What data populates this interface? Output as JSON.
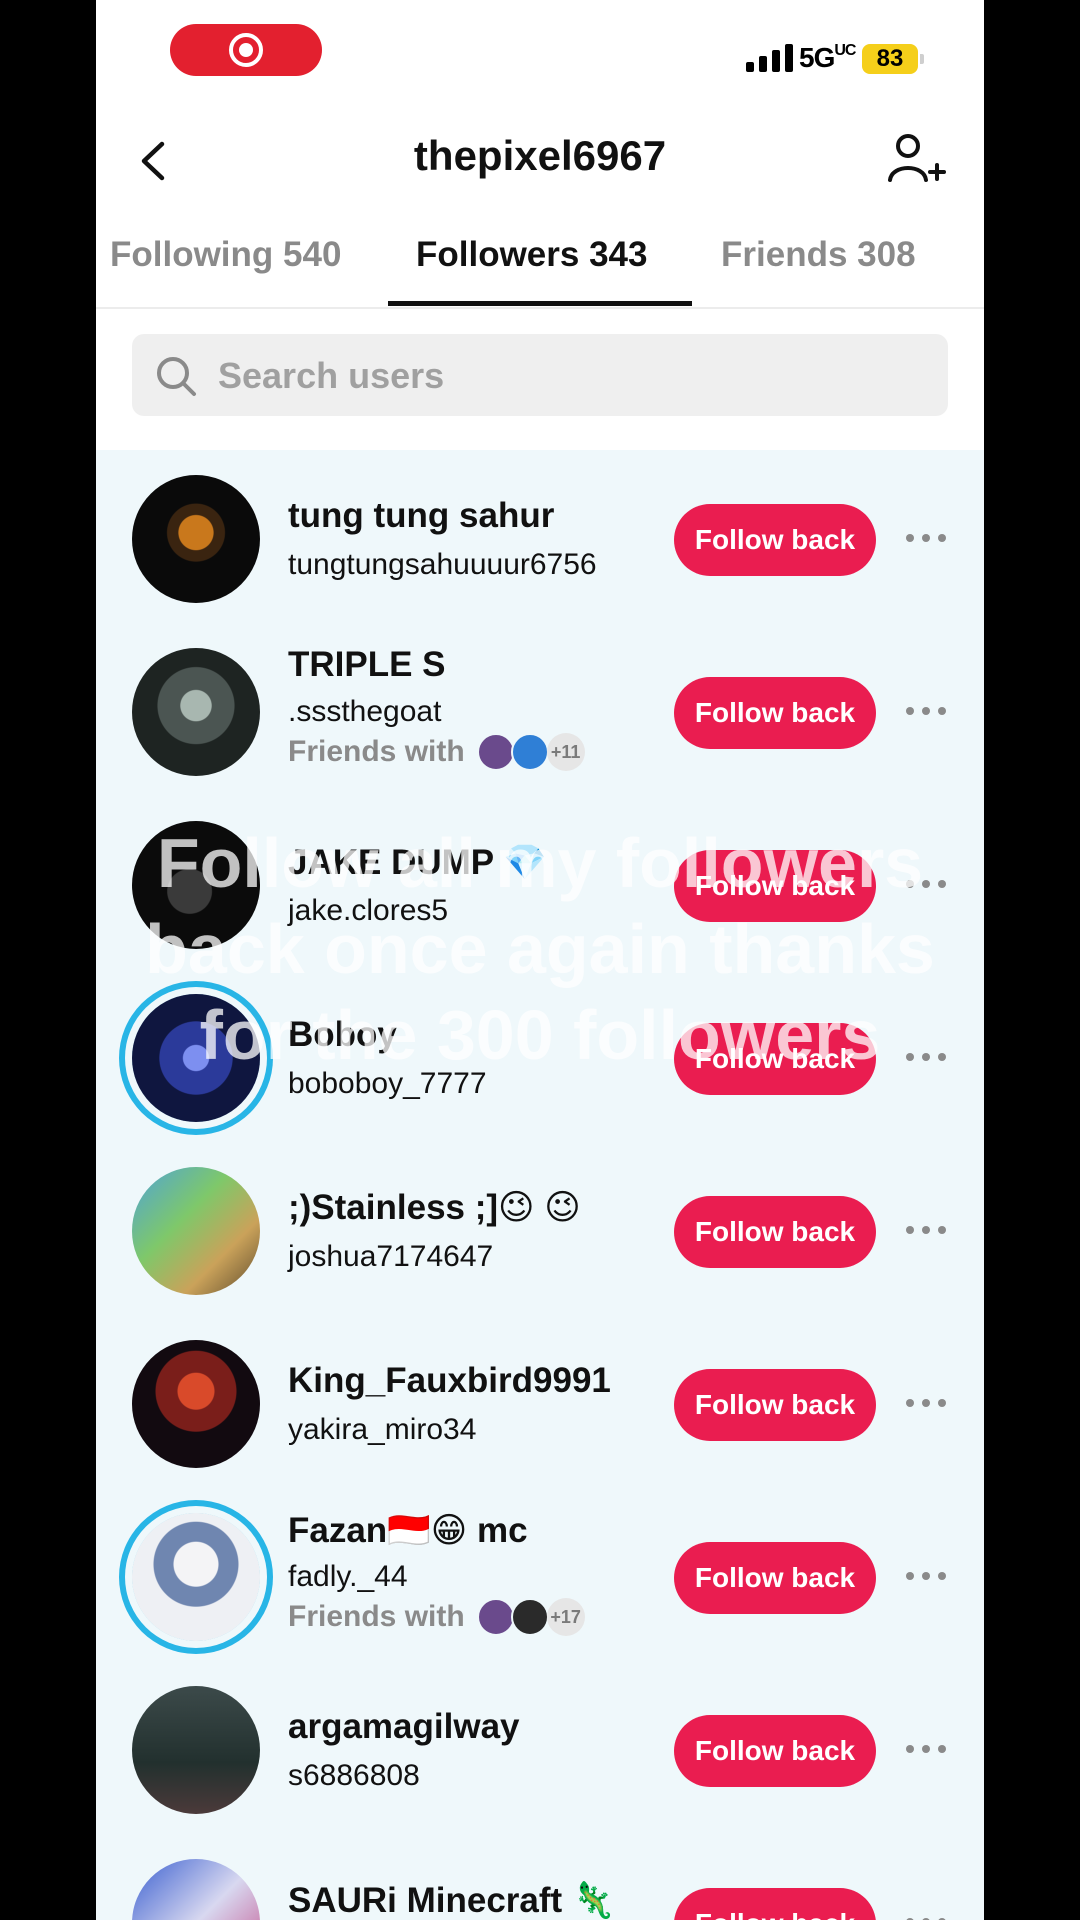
{
  "status_bar": {
    "network": "5G",
    "network_suffix": "UC",
    "battery": "83"
  },
  "header": {
    "title": "thepixel6967"
  },
  "tabs": [
    {
      "label": "Following 540",
      "active": false
    },
    {
      "label": "Followers 343",
      "active": true
    },
    {
      "label": "Friends 308",
      "active": false
    }
  ],
  "search": {
    "placeholder": "Search users"
  },
  "follow_label": "Follow back",
  "friends_with_label": "Friends with",
  "users": [
    {
      "name": "tung tung sahur",
      "handle": "tungtungsahuuuur6756"
    },
    {
      "name": "TRIPLE S",
      "handle": ".sssthegoat",
      "friends_count": "+11"
    },
    {
      "name": "JAKE DUMP 💎",
      "handle": "jake.clores5"
    },
    {
      "name": "Boboy",
      "handle": "boboboy_7777"
    },
    {
      "name": ";)Stainless ;]😉 😉",
      "handle": "joshua7174647"
    },
    {
      "name": "King_Fauxbird9991",
      "handle": "yakira_miro34"
    },
    {
      "name": "Fazan🇮🇩😁 mc",
      "handle": "fadly._44",
      "friends_count": "+17"
    },
    {
      "name": "argamagilway",
      "handle": "s6886808"
    },
    {
      "name": "SAURi Minecraft 🦎",
      "handle": ""
    }
  ],
  "overlay_caption": "Follow all my followers back once again thanks for the 300 followers",
  "colors": {
    "accent": "#ea1d50",
    "list_bg": "#eff8fb",
    "story_ring": "#28b5e6"
  }
}
